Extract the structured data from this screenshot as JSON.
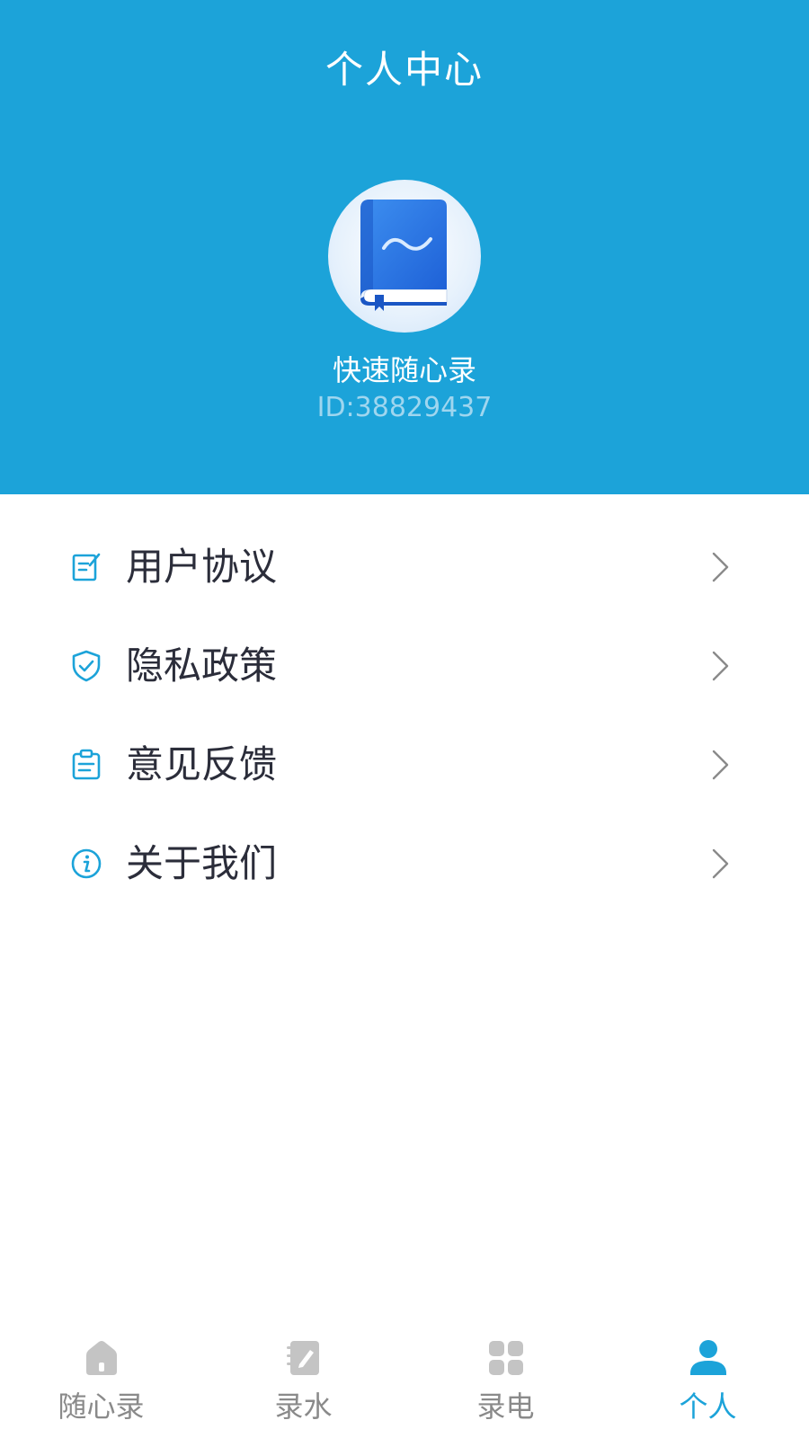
{
  "header": {
    "title": "个人中心",
    "username": "快速随心录",
    "user_id": "ID:38829437"
  },
  "menu": {
    "items": [
      {
        "label": "用户协议",
        "icon": "edit-document-icon"
      },
      {
        "label": "隐私政策",
        "icon": "shield-check-icon"
      },
      {
        "label": "意见反馈",
        "icon": "clipboard-icon"
      },
      {
        "label": "关于我们",
        "icon": "info-icon"
      }
    ]
  },
  "tabbar": {
    "tabs": [
      {
        "label": "随心录",
        "icon": "home-icon",
        "active": false
      },
      {
        "label": "录水",
        "icon": "note-pen-icon",
        "active": false
      },
      {
        "label": "录电",
        "icon": "grid-icon",
        "active": false
      },
      {
        "label": "个人",
        "icon": "person-icon",
        "active": true
      }
    ]
  },
  "colors": {
    "primary": "#1ca3d9",
    "text_dark": "#2b2d3a",
    "tab_inactive": "#8a8a8a",
    "id_text": "#9fd6ef"
  }
}
